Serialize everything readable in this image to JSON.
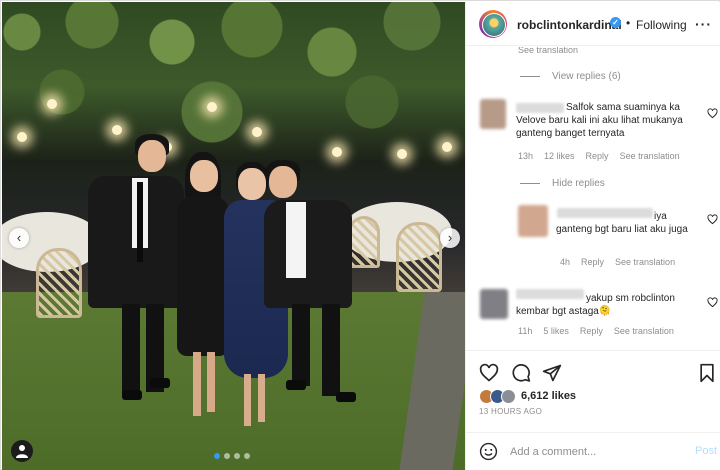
{
  "post": {
    "username": "robclintonkardinal",
    "follow_status": "Following",
    "image_alt": "group photo at garden wedding",
    "carousel": {
      "count": 4,
      "active_index": 0
    }
  },
  "comments": {
    "see_translation_top": "See translation",
    "view_replies": "View replies (6)",
    "items": [
      {
        "text": "Salfok sama suaminya ka Velove baru kali ini aku lihat mukanya ganteng banget ternyata",
        "time": "13h",
        "likes": "12 likes",
        "reply": "Reply",
        "translate": "See translation"
      }
    ],
    "hide_replies": "Hide replies",
    "reply_items": [
      {
        "text": "iya ganteng bgt baru liat aku juga",
        "time": "4h",
        "reply": "Reply",
        "translate": "See translation"
      }
    ],
    "items_after": [
      {
        "text": "yakup sm robclinton kembar bgt astaga🫠",
        "time": "11h",
        "likes": "5 likes",
        "reply": "Reply",
        "translate": "See translation"
      }
    ]
  },
  "actions": {
    "likes": "6,612 likes",
    "time_ago": "13 HOURS AGO",
    "icons": [
      "heart-icon",
      "comment-icon",
      "share-icon",
      "bookmark-icon"
    ]
  },
  "composer": {
    "placeholder": "Add a comment...",
    "post_label": "Post"
  },
  "colors": {
    "accent": "#3897f0",
    "muted": "#8e8e8e",
    "post_disabled": "#b2dffc"
  }
}
